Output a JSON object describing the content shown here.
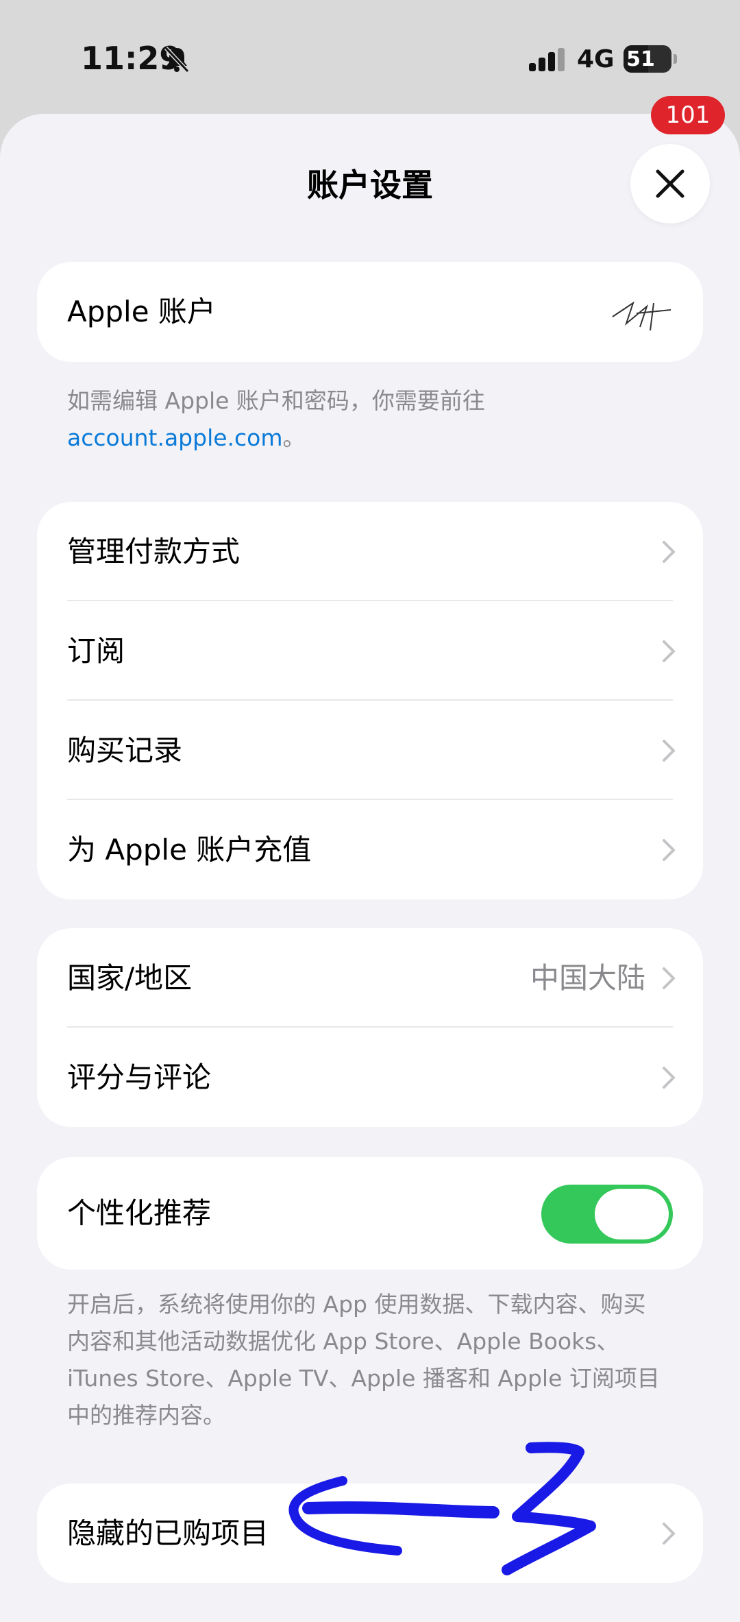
{
  "status_bar": {
    "time": "11:29",
    "network": "4G",
    "battery": "51",
    "battery_level_pct": 51,
    "notification_badge": "101"
  },
  "sheet": {
    "title": "账户设置"
  },
  "account_section": {
    "label": "Apple 账户",
    "footnote_text": "如需编辑 Apple 账户和密码，你需要前往",
    "footnote_link": "account.apple.com",
    "footnote_end": "。"
  },
  "payment_section": {
    "items": [
      {
        "label": "管理付款方式"
      },
      {
        "label": "订阅"
      },
      {
        "label": "购买记录"
      },
      {
        "label": "为 Apple 账户充值"
      }
    ]
  },
  "region_section": {
    "items": [
      {
        "label": "国家/地区",
        "value": "中国大陆"
      },
      {
        "label": "评分与评论"
      }
    ]
  },
  "personalization": {
    "label": "个性化推荐",
    "enabled": true,
    "footnote": [
      "开启后，系统将使用你的 App 使用数据、下载内容、购买",
      "内容和其他活动数据优化 App Store、Apple Books、",
      "iTunes Store、Apple TV、Apple 播客和 Apple 订阅项目",
      "中的推荐内容。"
    ]
  },
  "hidden_purchases": {
    "label": "隐藏的已购项目"
  },
  "colors": {
    "toggle_on": "#34c759",
    "link": "#0a7ad8",
    "annotation": "#1a1ae6",
    "badge": "#e0242c"
  }
}
